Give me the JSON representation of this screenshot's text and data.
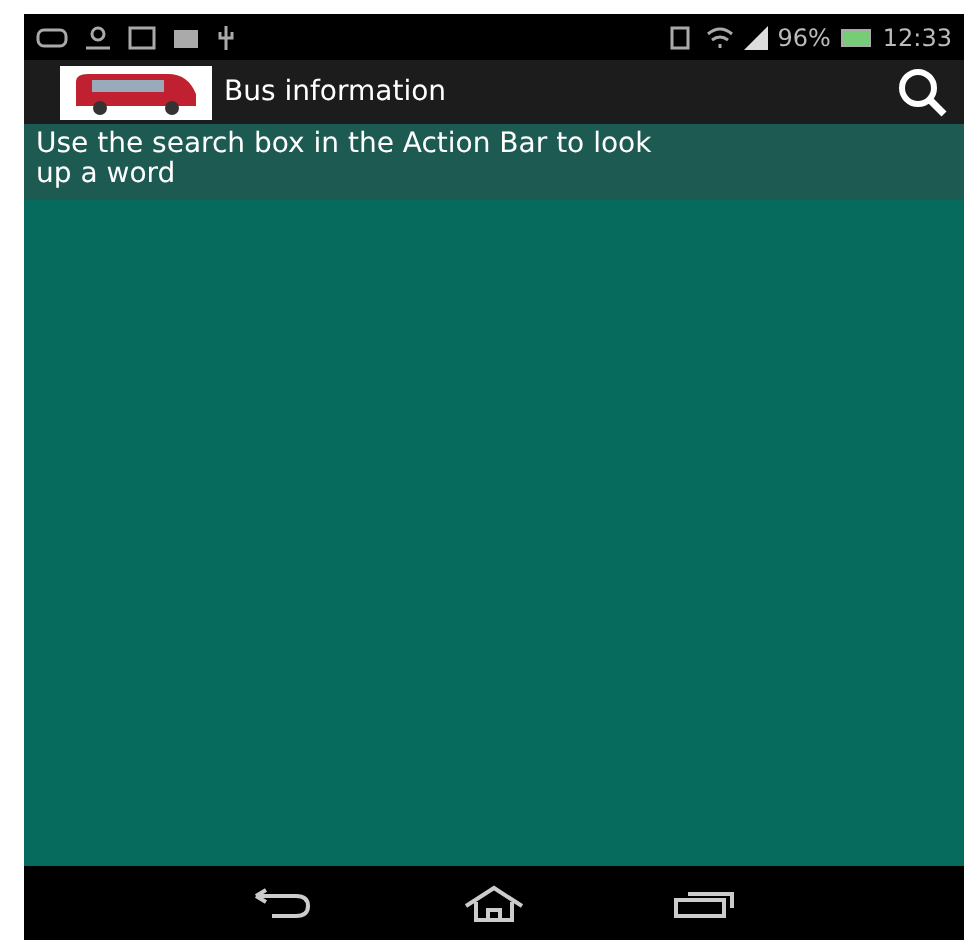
{
  "status_bar": {
    "battery": "96%",
    "time": "12:33"
  },
  "action_bar": {
    "title": "Bus information"
  },
  "message": "Use the search box in the Action Bar to look up a word"
}
